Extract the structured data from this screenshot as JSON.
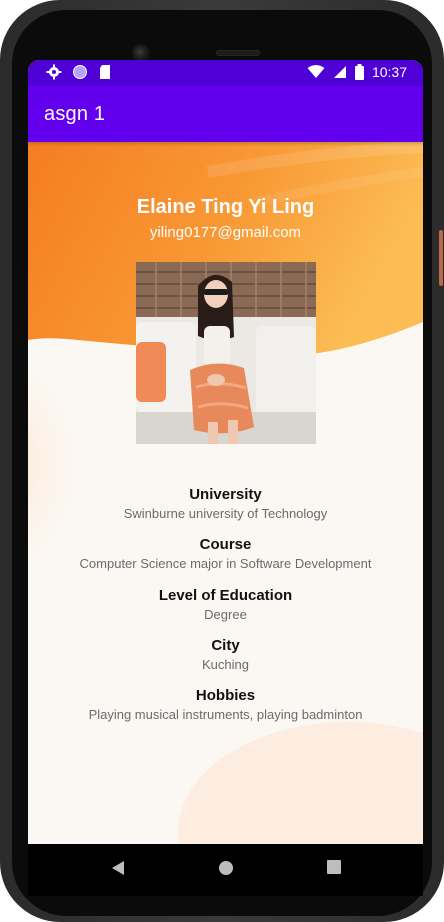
{
  "status_bar": {
    "time": "10:37",
    "icons_left": [
      "gear-icon",
      "circle-icon",
      "sd-card-icon"
    ],
    "icons_right": [
      "wifi-icon",
      "cell-signal-icon",
      "battery-icon"
    ]
  },
  "app_bar": {
    "title": "asgn 1"
  },
  "profile": {
    "name": "Elaine Ting Yi Ling",
    "email": "yiling0177@gmail.com",
    "photo_icon": "profile-photo"
  },
  "info": [
    {
      "label": "University",
      "value": "Swinburne university of Technology"
    },
    {
      "label": "Course",
      "value": "Computer Science major in Software Development"
    },
    {
      "label": "Level of Education",
      "value": "Degree"
    },
    {
      "label": "City",
      "value": "Kuching"
    },
    {
      "label": "Hobbies",
      "value": "Playing musical instruments, playing badminton"
    }
  ],
  "nav": {
    "icons": [
      "back-icon",
      "home-icon",
      "recents-icon"
    ]
  },
  "colors": {
    "status_bar": "#4e00d6",
    "app_bar": "#6200ee",
    "orange_top": "#f7862a",
    "orange_right": "#fbb24a",
    "background": "#fbf8f4"
  }
}
